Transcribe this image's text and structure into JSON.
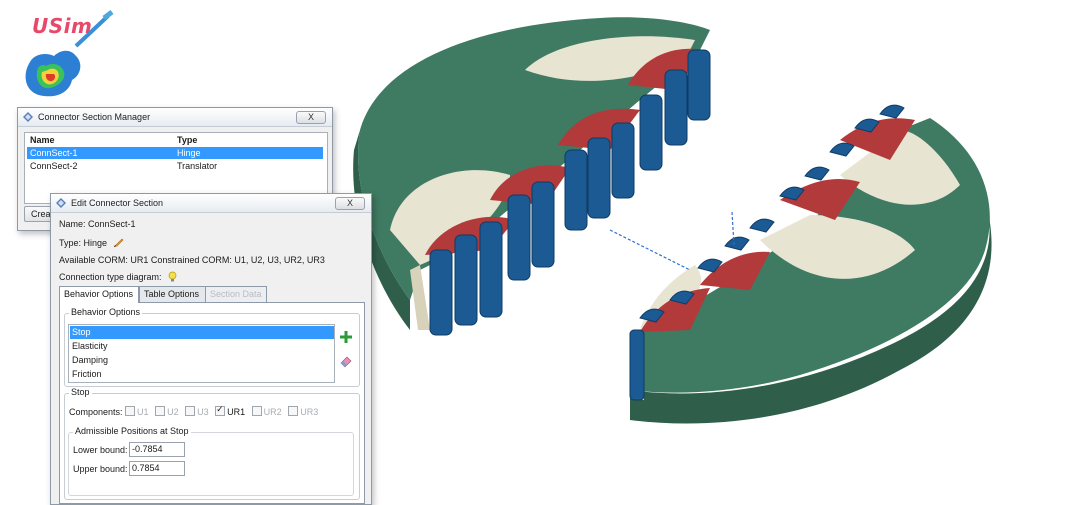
{
  "logo": {
    "text": "USim"
  },
  "manager": {
    "title": "Connector Section Manager",
    "close_label": "X",
    "columns": [
      "Name",
      "Type"
    ],
    "rows": [
      {
        "name": "ConnSect-1",
        "type": "Hinge",
        "selected": true
      },
      {
        "name": "ConnSect-2",
        "type": "Translator",
        "selected": false
      }
    ],
    "create_label": "Crea"
  },
  "edit": {
    "title": "Edit Connector Section",
    "close_label": "X",
    "name_label": "Name:",
    "name_value": "ConnSect-1",
    "type_label": "Type:",
    "type_value": "Hinge",
    "corm_text": "Available CORM:  UR1   Constrained CORM:  U1, U2, U3, UR2, UR3",
    "diagram_label": "Connection type diagram:",
    "tabs": [
      {
        "label": "Behavior Options",
        "state": "active"
      },
      {
        "label": "Table Options",
        "state": "normal"
      },
      {
        "label": "Section Data",
        "state": "disabled"
      }
    ],
    "behavior_group_label": "Behavior Options",
    "behaviors": [
      "Stop",
      "Elasticity",
      "Damping",
      "Friction"
    ],
    "selected_behavior": "Stop",
    "stop_group_label": "Stop",
    "components_label": "Components:",
    "components": [
      {
        "label": "U1",
        "checked": false
      },
      {
        "label": "U2",
        "checked": false
      },
      {
        "label": "U3",
        "checked": false
      },
      {
        "label": "UR1",
        "checked": true
      },
      {
        "label": "UR2",
        "checked": false
      },
      {
        "label": "UR3",
        "checked": false
      }
    ],
    "positions_group_label": "Admissible Positions at Stop",
    "lower_label": "Lower bound:",
    "lower_value": "-0.7854",
    "upper_label": "Upper bound:",
    "upper_value": "0.7854"
  },
  "colors": {
    "disk_green": "#3f7a62",
    "disk_green_dark": "#2f5f4b",
    "cream": "#e8e4d2",
    "red": "#b23a3a",
    "blue": "#1b5a93",
    "selection": "#3399ff"
  }
}
